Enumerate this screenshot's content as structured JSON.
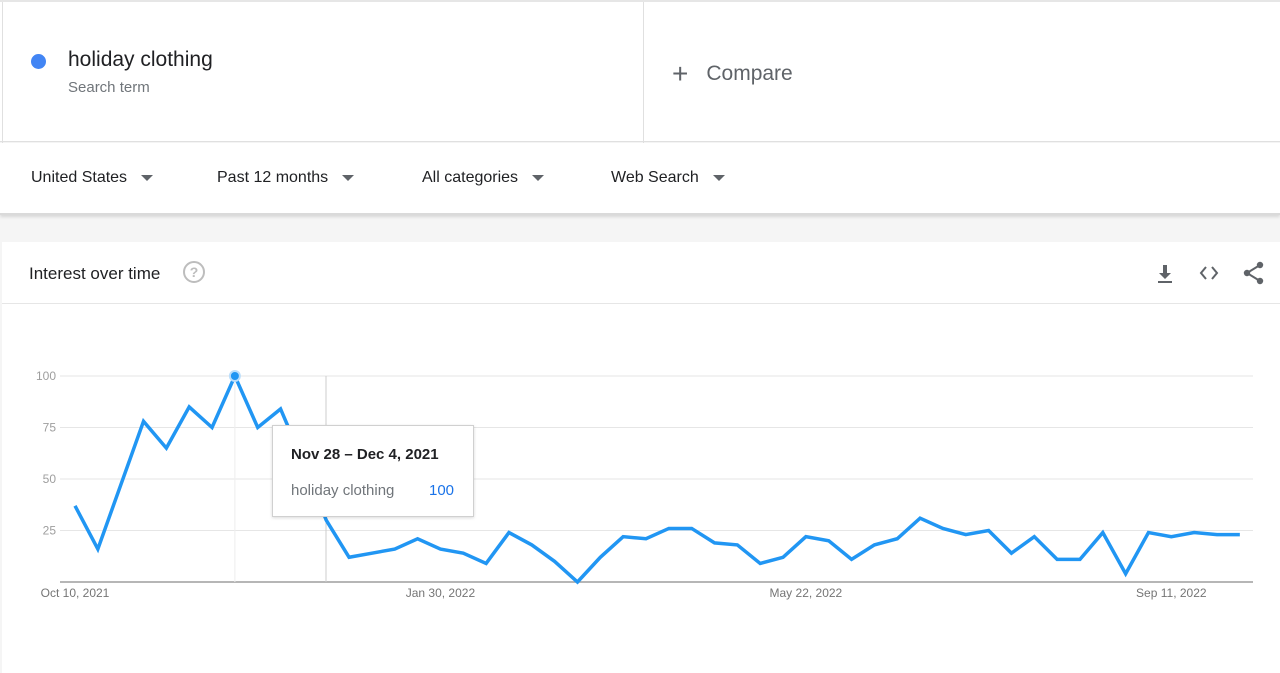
{
  "search_term": {
    "name": "holiday clothing",
    "label": "Search term",
    "color": "#4285f4"
  },
  "compare": {
    "label": "Compare",
    "icon": "plus-icon"
  },
  "filters": [
    {
      "label": "United States"
    },
    {
      "label": "Past 12 months"
    },
    {
      "label": "All categories"
    },
    {
      "label": "Web Search"
    }
  ],
  "card": {
    "title": "Interest over time",
    "help_icon": "help-icon",
    "tools": [
      "download-icon",
      "embed-icon",
      "share-icon"
    ]
  },
  "tooltip": {
    "date": "Nov 28 – Dec 4, 2021",
    "term": "holiday clothing",
    "value": "100"
  },
  "chart_data": {
    "type": "line",
    "title": "",
    "xlabel": "",
    "ylabel": "",
    "ylim": [
      0,
      100
    ],
    "y_ticks": [
      "25",
      "50",
      "75",
      "100"
    ],
    "x_tick_labels": [
      "Oct 10, 2021",
      "Jan 30, 2022",
      "May 22, 2022",
      "Sep 11, 2022"
    ],
    "x_tick_label_week_index": [
      0,
      16,
      32,
      48
    ],
    "x_start": "Oct 10, 2021",
    "x_interval": "weekly",
    "grid": true,
    "highlighted_week": "Nov 28 – Dec 4, 2021",
    "series": [
      {
        "name": "holiday clothing",
        "color": "#2196f3",
        "values": [
          37,
          16,
          47,
          78,
          65,
          85,
          75,
          100,
          75,
          84,
          58,
          30,
          12,
          14,
          16,
          21,
          16,
          14,
          9,
          24,
          18,
          10,
          0,
          12,
          22,
          21,
          26,
          26,
          19,
          18,
          9,
          12,
          22,
          20,
          11,
          18,
          21,
          31,
          26,
          23,
          25,
          14,
          22,
          11,
          11,
          24,
          4,
          24,
          22,
          24,
          23,
          23
        ]
      }
    ]
  }
}
